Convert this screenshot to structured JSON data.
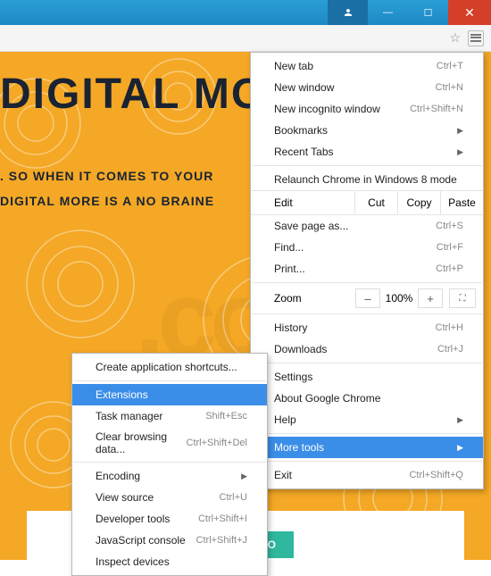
{
  "titlebar": {
    "user": "▾",
    "min": "—",
    "max": "☐",
    "close": "✕"
  },
  "topbar": {
    "star": "☆"
  },
  "hero": {
    "title": "DIGITAL MO",
    "line1": ". SO WHEN IT COMES TO YOUR",
    "line2": "DIGITAL MORE IS A NO BRAINE"
  },
  "watermark": ".com",
  "cta": {
    "more": "MORE INFO"
  },
  "menu": {
    "new_tab": "New tab",
    "new_tab_sc": "Ctrl+T",
    "new_window": "New window",
    "new_window_sc": "Ctrl+N",
    "new_incognito": "New incognito window",
    "new_incognito_sc": "Ctrl+Shift+N",
    "bookmarks": "Bookmarks",
    "recent_tabs": "Recent Tabs",
    "relaunch": "Relaunch Chrome in Windows 8 mode",
    "edit": "Edit",
    "cut": "Cut",
    "copy": "Copy",
    "paste": "Paste",
    "save_as": "Save page as...",
    "save_as_sc": "Ctrl+S",
    "find": "Find...",
    "find_sc": "Ctrl+F",
    "print": "Print...",
    "print_sc": "Ctrl+P",
    "zoom": "Zoom",
    "zoom_minus": "–",
    "zoom_val": "100%",
    "zoom_plus": "+",
    "zoom_full": "⛶",
    "history": "History",
    "history_sc": "Ctrl+H",
    "downloads": "Downloads",
    "downloads_sc": "Ctrl+J",
    "settings": "Settings",
    "about": "About Google Chrome",
    "help": "Help",
    "more_tools": "More tools",
    "exit": "Exit",
    "exit_sc": "Ctrl+Shift+Q"
  },
  "submenu": {
    "create_shortcut": "Create application shortcuts...",
    "extensions": "Extensions",
    "task_manager": "Task manager",
    "task_manager_sc": "Shift+Esc",
    "clear_data": "Clear browsing data...",
    "clear_data_sc": "Ctrl+Shift+Del",
    "encoding": "Encoding",
    "view_source": "View source",
    "view_source_sc": "Ctrl+U",
    "dev_tools": "Developer tools",
    "dev_tools_sc": "Ctrl+Shift+I",
    "js_console": "JavaScript console",
    "js_console_sc": "Ctrl+Shift+J",
    "inspect": "Inspect devices"
  }
}
